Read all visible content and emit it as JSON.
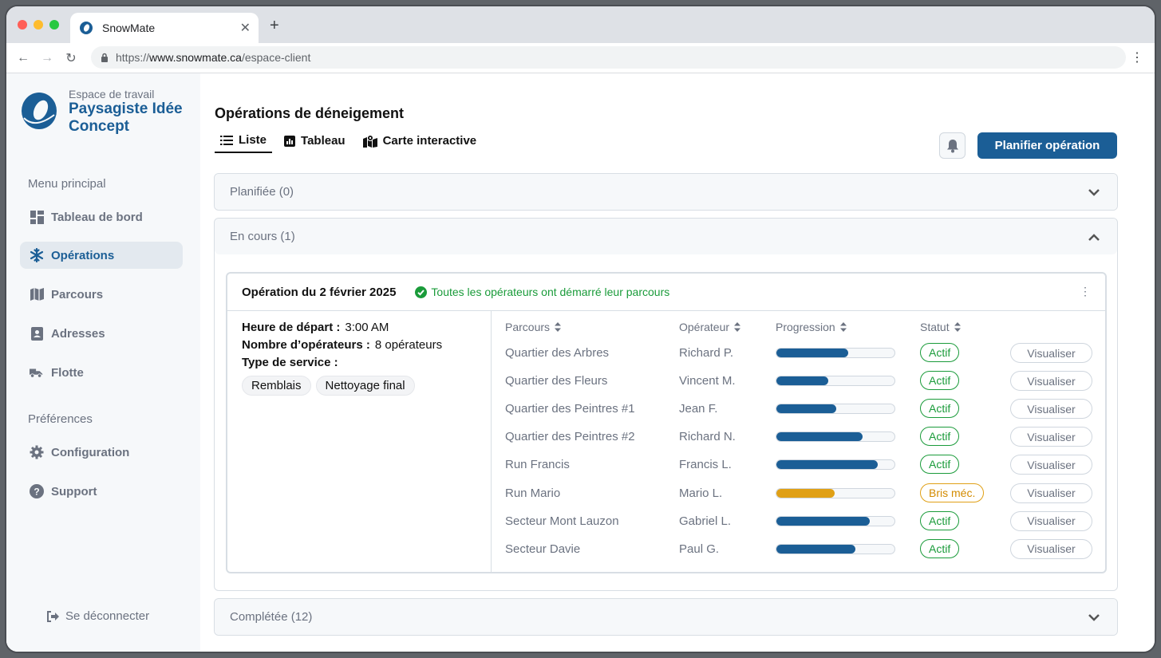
{
  "browser": {
    "tab_title": "SnowMate",
    "url_prefix": "https://",
    "url_domain": "www.snowmate.ca",
    "url_path": "/espace-client",
    "new_tab_symbol": "+"
  },
  "sidebar": {
    "workspace_label": "Espace de travail",
    "workspace_name": "Paysagiste Idée Concept",
    "menu_label": "Menu principal",
    "menu_items": [
      {
        "label": "Tableau de bord",
        "icon": "dashboard-icon",
        "active": false
      },
      {
        "label": "Opérations",
        "icon": "snowflake-icon",
        "active": true
      },
      {
        "label": "Parcours",
        "icon": "map-icon",
        "active": false
      },
      {
        "label": "Adresses",
        "icon": "address-book-icon",
        "active": false
      },
      {
        "label": "Flotte",
        "icon": "truck-icon",
        "active": false
      }
    ],
    "preferences_label": "Préférences",
    "preference_items": [
      {
        "label": "Configuration",
        "icon": "gear-icon"
      },
      {
        "label": "Support",
        "icon": "help-icon"
      }
    ],
    "logout_label": "Se déconnecter"
  },
  "main": {
    "title": "Opérations de déneigement",
    "view_tabs": [
      {
        "label": "Liste",
        "icon": "list-icon",
        "active": true
      },
      {
        "label": "Tableau",
        "icon": "chart-icon",
        "active": false
      },
      {
        "label": "Carte interactive",
        "icon": "map-marker-icon",
        "active": false
      }
    ],
    "plan_button": "Planifier opération",
    "sections": {
      "planned": "Planifiée (0)",
      "in_progress": "En cours (1)",
      "completed": "Complétée (12)"
    },
    "operation": {
      "title": "Opération du 2 février 2025",
      "status": "Toutes les opérateurs ont démarré leur parcours",
      "departure_label": "Heure de départ :",
      "departure_value": "3:00 AM",
      "operators_label": "Nombre d’opérateurs :",
      "operators_value": "8 opérateurs",
      "service_label": "Type de service :",
      "services": [
        "Remblais",
        "Nettoyage final"
      ],
      "columns": [
        "Parcours",
        "Opérateur",
        "Progression",
        "Statut"
      ],
      "view_label": "Visualiser",
      "rows": [
        {
          "route": "Quartier des Arbres",
          "operator": "Richard P.",
          "progress": 0.61,
          "status": "Actif",
          "warn": false
        },
        {
          "route": "Quartier des Fleurs",
          "operator": "Vincent M.",
          "progress": 0.44,
          "status": "Actif",
          "warn": false
        },
        {
          "route": "Quartier des Peintres #1",
          "operator": "Jean F.",
          "progress": 0.51,
          "status": "Actif",
          "warn": false
        },
        {
          "route": "Quartier des Peintres #2",
          "operator": "Richard N.",
          "progress": 0.73,
          "status": "Actif",
          "warn": false
        },
        {
          "route": "Run Francis",
          "operator": "Francis L.",
          "progress": 0.86,
          "status": "Actif",
          "warn": false
        },
        {
          "route": "Run Mario",
          "operator": "Mario L.",
          "progress": 0.49,
          "status": "Bris méc.",
          "warn": true
        },
        {
          "route": "Secteur Mont Lauzon",
          "operator": "Gabriel L.",
          "progress": 0.79,
          "status": "Actif",
          "warn": false
        },
        {
          "route": "Secteur Davie",
          "operator": "Paul G.",
          "progress": 0.67,
          "status": "Actif",
          "warn": false
        }
      ]
    }
  },
  "colors": {
    "brand": "#1b5e96",
    "progress_normal": "#1b5e96",
    "progress_warn": "#e0a016",
    "status_ok": "#1a9b3a",
    "status_warn": "#e0a016"
  }
}
